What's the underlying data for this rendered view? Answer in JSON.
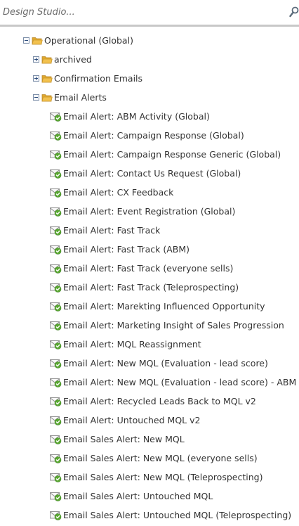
{
  "search": {
    "placeholder": "Design Studio..."
  },
  "tree": {
    "root": {
      "label": "Operational (Global)",
      "children": [
        {
          "label": "archived",
          "expanded": false
        },
        {
          "label": "Confirmation Emails",
          "expanded": false
        },
        {
          "label": "Email Alerts",
          "expanded": true
        }
      ]
    },
    "email_alerts": [
      "Email Alert: ABM Activity (Global)",
      "Email Alert: Campaign Response (Global)",
      "Email Alert: Campaign Response Generic (Global)",
      "Email Alert: Contact Us Request (Global)",
      "Email Alert: CX Feedback",
      "Email Alert: Event Registration (Global)",
      "Email Alert: Fast Track",
      "Email Alert: Fast Track (ABM)",
      "Email Alert: Fast Track (everyone sells)",
      "Email Alert: Fast Track (Teleprospecting)",
      "Email Alert: Marekting Influenced Opportunity",
      "Email Alert: Marketing Insight of Sales Progression",
      "Email Alert: MQL Reassignment",
      "Email Alert: New MQL (Evaluation - lead score)",
      "Email Alert: New MQL (Evaluation - lead score) - ABM",
      "Email Alert: Recycled Leads Back to MQL v2",
      "Email Alert: Untouched MQL v2",
      "Email Sales Alert: New MQL",
      "Email Sales Alert: New MQL (everyone sells)",
      "Email Sales Alert: New MQL (Teleprospecting)",
      "Email Sales Alert: Untouched MQL",
      "Email Sales Alert: Untouched MQL (Teleprospecting)"
    ]
  },
  "icons": {
    "search": "magnifier-icon",
    "folder": "folder-icon",
    "expand": "plus-expander-icon",
    "collapse": "minus-expander-icon",
    "email": "approved-email-icon"
  },
  "colors": {
    "folder": "#f2c14e",
    "email_check": "#5aa832",
    "divider": "#c8c8c8"
  }
}
